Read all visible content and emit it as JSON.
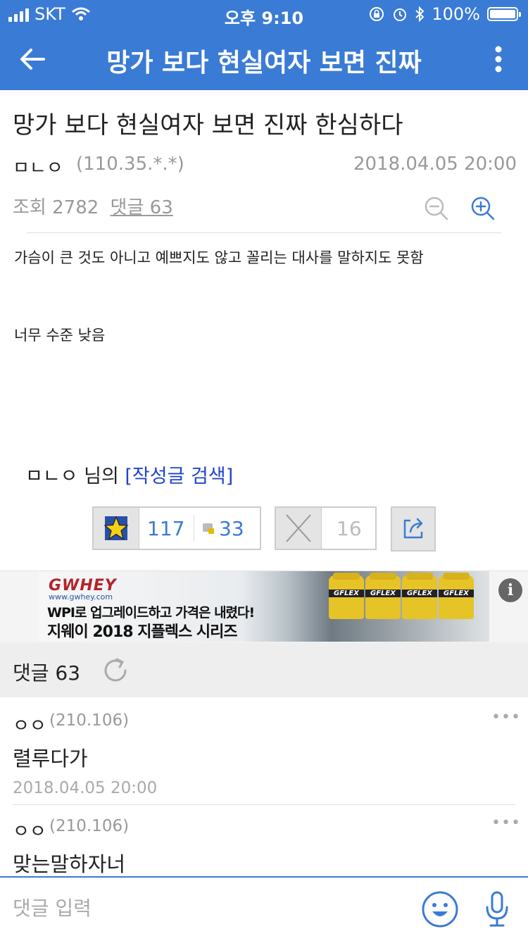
{
  "status_bar": {
    "carrier": "SKT",
    "time": "오후 9:10",
    "battery": "100%"
  },
  "header": {
    "title": "망가 보다 현실여자 보면 진짜"
  },
  "post": {
    "title": "망가 보다 현실여자 보면 진짜 한심하다",
    "author": "ㅁㄴㅇ",
    "ip": "(110.35.*.*)",
    "date": "2018.04.05 20:00",
    "views_label": "조회 2782",
    "comments_link": "댓글 63",
    "body": [
      "가슴이 큰 것도 아니고 예쁘지도 않고 꼴리는 대사를 말하지도 못함",
      "너무 수준 낮음"
    ],
    "author_search": {
      "author": "ㅁㄴㅇ",
      "suffix": " 님의 ",
      "link": "[작성글 검색]"
    }
  },
  "votes": {
    "up_count": "117",
    "up_secondary": "33",
    "down_count": "16"
  },
  "ad": {
    "brand": "GWHEY",
    "url": "www.gwhey.com",
    "line1": "WPI로 업그레이드하고 가격은 내렸다!",
    "line2": "지웨이 2018 지플렉스 시리즈",
    "products": [
      "GFLEX",
      "GFLEX",
      "GFLEX",
      "GFLEX"
    ],
    "info_icon": "i"
  },
  "comments_header": {
    "label": "댓글 63"
  },
  "comments": [
    {
      "author": "ㅇㅇ",
      "ip": "(210.106)",
      "text": "렬루다가",
      "date": "2018.04.05 20:00",
      "menu": "•••"
    },
    {
      "author": "ㅇㅇ",
      "ip": "(210.106)",
      "text": "맞는말하자너",
      "menu": "•••"
    }
  ],
  "input_bar": {
    "placeholder": "댓글 입력"
  },
  "colors": {
    "brand_blue": "#3a7bd5",
    "link_blue": "#2244cc",
    "muted_gray": "#999999"
  }
}
